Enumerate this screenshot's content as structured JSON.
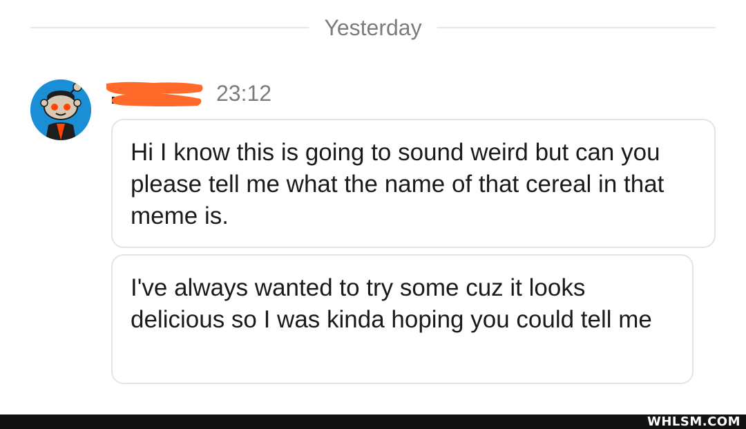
{
  "divider": {
    "label": "Yesterday"
  },
  "message_group": {
    "avatar_icon": "reddit-snoo-avatar-icon",
    "timestamp": "23:12",
    "messages": [
      {
        "text": "Hi I know this is going to sound weird but can you please tell me what the name of that cereal in that meme is."
      },
      {
        "text": "I've always wanted to try some cuz it looks delicious so I was kinda hoping you could tell me"
      }
    ]
  },
  "watermark": {
    "text": "WHLSM.COM"
  },
  "colors": {
    "redaction": "#ff6a2b",
    "avatar_bg": "#1a8fd6",
    "bubble_border": "#e4e4e4",
    "muted_text": "#7c7c7c"
  }
}
